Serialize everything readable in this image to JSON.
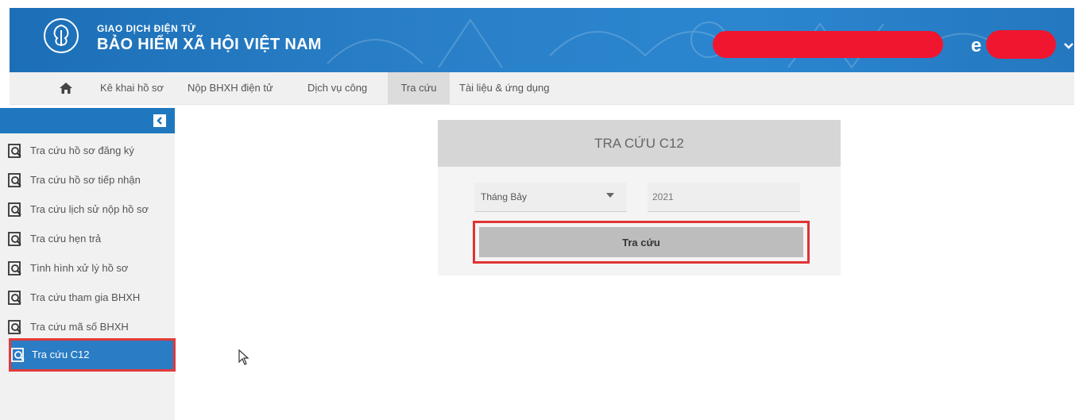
{
  "header": {
    "title_small": "GIAO DỊCH ĐIỆN TỬ",
    "title_big": "BẢO HIỂM XÃ HỘI VIỆT NAM",
    "user_initial": "e"
  },
  "nav": {
    "items": [
      {
        "label": "Kê khai hồ sơ"
      },
      {
        "label": "Nộp BHXH điện tử"
      },
      {
        "label": "Dịch vụ công"
      },
      {
        "label": "Tra cứu"
      },
      {
        "label": "Tài liệu & ứng dụng"
      }
    ],
    "active": "Tra cứu"
  },
  "sidebar": {
    "items": [
      {
        "label": "Tra cứu hồ sơ đăng ký"
      },
      {
        "label": "Tra cứu hồ sơ tiếp nhận"
      },
      {
        "label": "Tra cứu lịch sử nộp hồ sơ"
      },
      {
        "label": "Tra cứu hẹn trả"
      },
      {
        "label": "Tình hình xử lý hồ sơ"
      },
      {
        "label": "Tra cứu tham gia BHXH"
      },
      {
        "label": "Tra cứu mã số BHXH"
      },
      {
        "label": "Tra cứu C12"
      }
    ],
    "active": "Tra cứu C12"
  },
  "panel": {
    "title": "TRA CỨU C12",
    "month_value": "Tháng Bảy",
    "year_value": "2021",
    "submit_label": "Tra cứu"
  },
  "colors": {
    "header_blue": "#2478bf",
    "highlight_red": "#e13333",
    "redaction_red": "#f0162f"
  }
}
